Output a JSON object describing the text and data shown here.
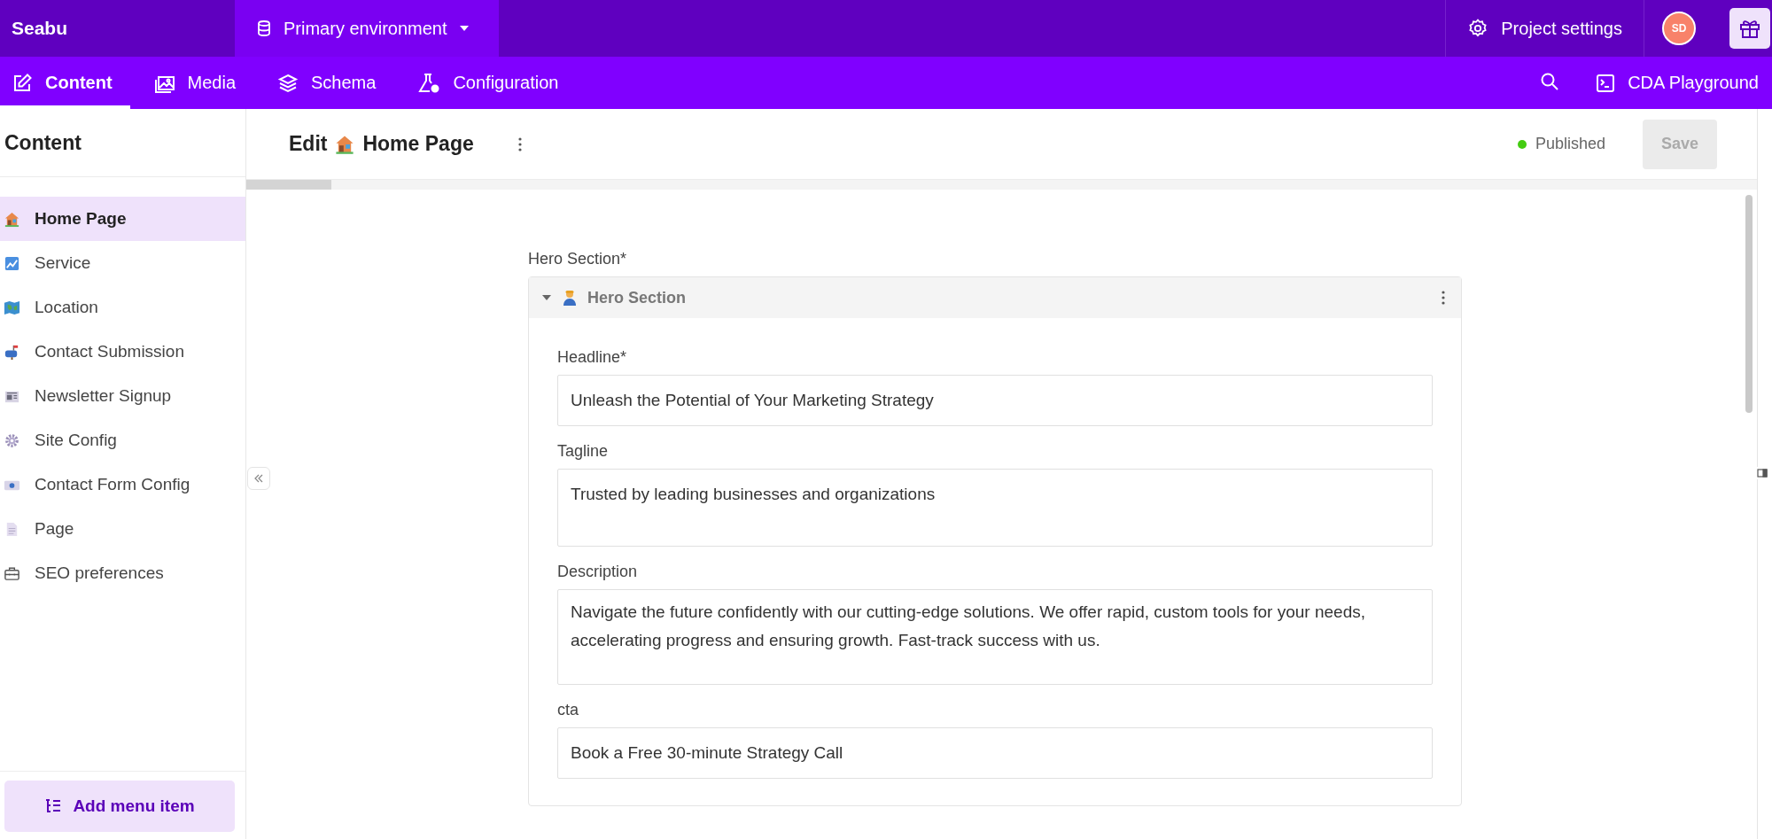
{
  "topbar": {
    "brand": "Seabu",
    "environment": "Primary environment",
    "project_settings": "Project settings",
    "avatar": "SD"
  },
  "nav": {
    "tabs": [
      {
        "label": "Content",
        "kind": "edit",
        "selected": true
      },
      {
        "label": "Media",
        "kind": "image",
        "selected": false
      },
      {
        "label": "Schema",
        "kind": "layers",
        "selected": false
      },
      {
        "label": "Configuration",
        "kind": "flask",
        "selected": false
      }
    ],
    "playground": "CDA Playground"
  },
  "sidebar": {
    "title": "Content",
    "items": [
      {
        "label": "Home Page",
        "kind": "house",
        "selected": true
      },
      {
        "label": "Service",
        "kind": "chart",
        "selected": false
      },
      {
        "label": "Location",
        "kind": "map",
        "selected": false
      },
      {
        "label": "Contact Submission",
        "kind": "mailbox",
        "selected": false
      },
      {
        "label": "Newsletter Signup",
        "kind": "newspaper",
        "selected": false
      },
      {
        "label": "Site Config",
        "kind": "gear",
        "selected": false
      },
      {
        "label": "Contact Form Config",
        "kind": "card",
        "selected": false
      },
      {
        "label": "Page",
        "kind": "document",
        "selected": false
      },
      {
        "label": "SEO preferences",
        "kind": "toolbox",
        "selected": false
      }
    ],
    "add_button": "Add menu item"
  },
  "editor": {
    "title_prefix": "Edit",
    "title": "Home Page",
    "status": "Published",
    "save": {
      "label": "Save",
      "disabled": true
    },
    "section_label": "Hero Section*",
    "section": {
      "title": "Hero Section",
      "expanded": true,
      "fields": [
        {
          "label": "Headline*",
          "kind": "input",
          "value": "Unleash the Potential of Your Marketing Strategy"
        },
        {
          "label": "Tagline",
          "kind": "textarea",
          "value": "Trusted by leading businesses and organizations"
        },
        {
          "label": "Description",
          "kind": "textarea",
          "value": "Navigate the future confidently with our cutting-edge solutions. We offer rapid, custom tools for your needs, accelerating progress and ensuring growth. Fast-track success with us."
        },
        {
          "label": "cta",
          "kind": "input",
          "value": "Book a Free 30-minute Strategy Call"
        }
      ]
    }
  }
}
